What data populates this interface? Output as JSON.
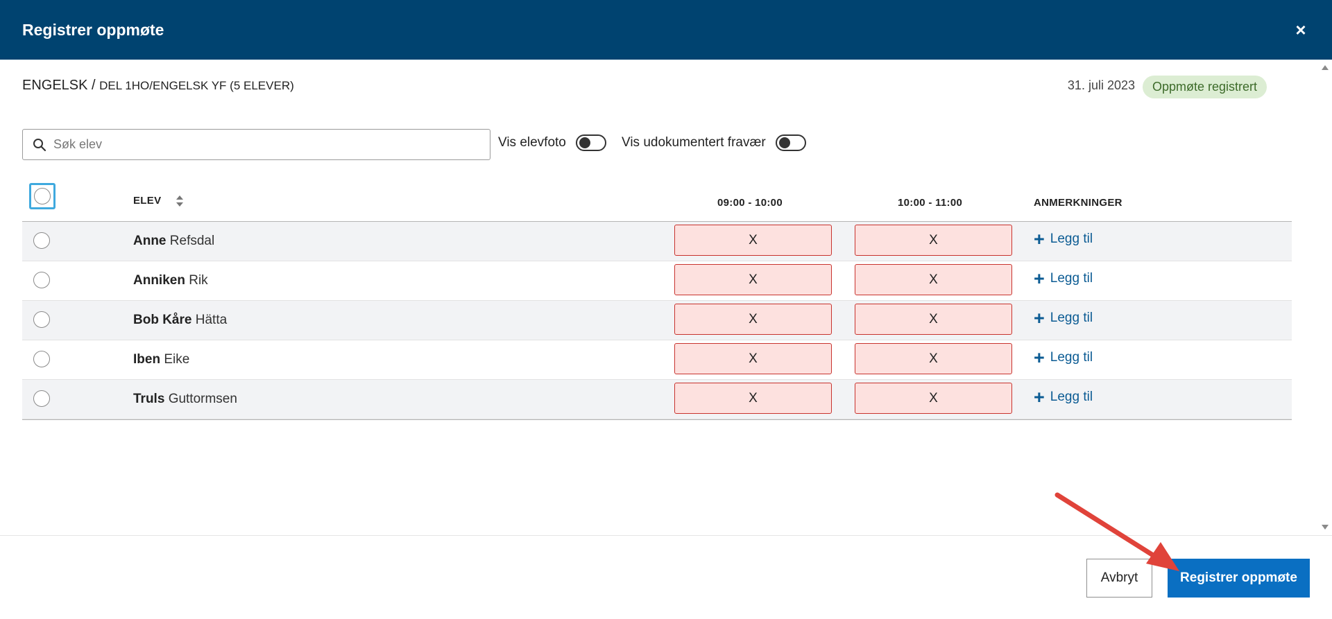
{
  "header": {
    "title": "Registrer oppmøte",
    "close_label": "×"
  },
  "course": {
    "subject": "ENGELSK",
    "separator": " / ",
    "group": "DEL 1HO/ENGELSK YF (5 ELEVER)"
  },
  "date": "31. juli 2023",
  "status": {
    "label": "Oppmøte registrert",
    "bg": "#dcedd3",
    "fg": "#3d6b2a"
  },
  "search": {
    "placeholder": "Søk elev",
    "value": ""
  },
  "toggles": {
    "photo_label": "Vis elevfoto",
    "absence_label": "Vis udokumentert fravær"
  },
  "table": {
    "col_student": "ELEV",
    "col_slot1": "09:00 - 10:00",
    "col_slot2": "10:00 - 11:00",
    "col_notes": "ANMERKNINGER",
    "add_label": "Legg til",
    "mark": "X",
    "rows": [
      {
        "first": "Anne",
        "last": "Refsdal"
      },
      {
        "first": "Anniken",
        "last": "Rik"
      },
      {
        "first": "Bob Kåre",
        "last": "Hätta"
      },
      {
        "first": "Iben",
        "last": "Eike"
      },
      {
        "first": "Truls",
        "last": "Guttormsen"
      }
    ]
  },
  "footer": {
    "cancel_label": "Avbryt",
    "submit_label": "Registrer oppmøte"
  },
  "colors": {
    "header": "#004370",
    "primary": "#0a6fc2",
    "absent_bg": "#fde1df",
    "absent_border": "#c8322d",
    "arrow": "#e0433a"
  }
}
